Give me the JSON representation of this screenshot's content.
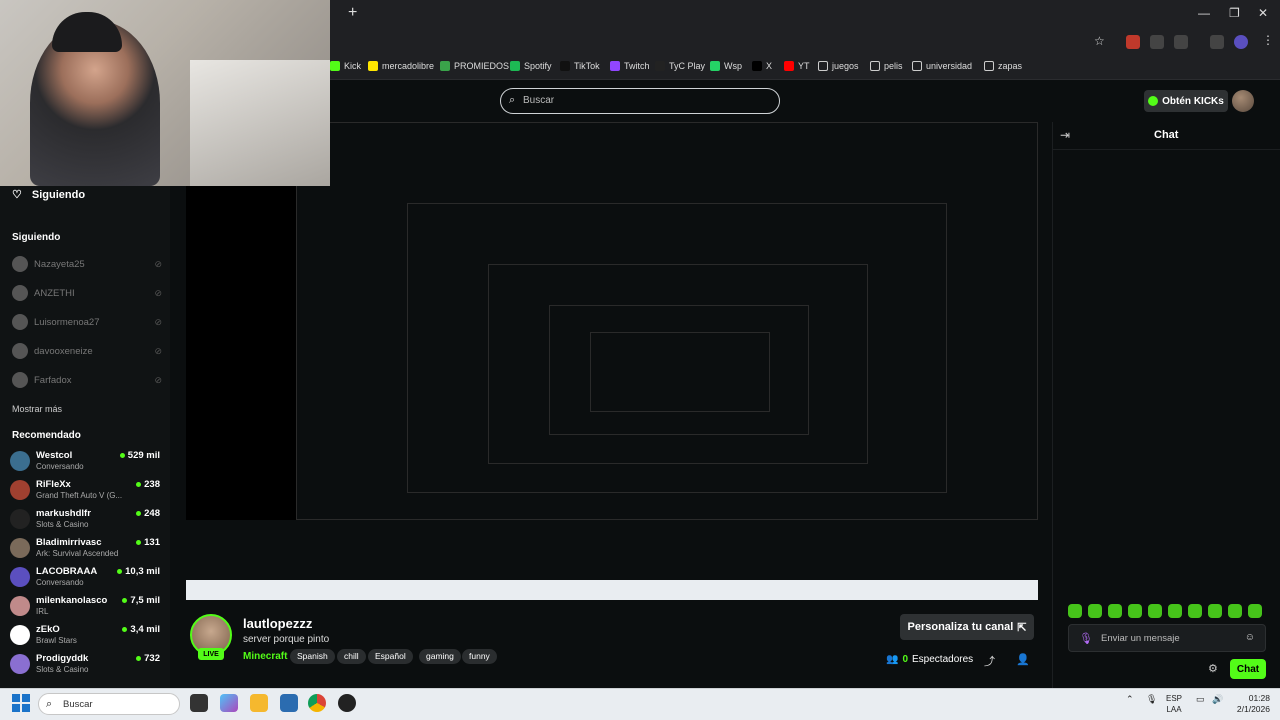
{
  "browser": {
    "new_tab": "+",
    "window_controls": [
      "—",
      "❐",
      "✕"
    ],
    "bookmarks": [
      {
        "label": "Kick",
        "color": "#53fc18"
      },
      {
        "label": "mercadolibre",
        "color": "#ffe600"
      },
      {
        "label": "PROMIEDOS",
        "color": "#3aa34a"
      },
      {
        "label": "Spotify",
        "color": "#1db954"
      },
      {
        "label": "TikTok",
        "color": "#111111"
      },
      {
        "label": "Twitch",
        "color": "#9146ff"
      },
      {
        "label": "TyC Play",
        "color": "#222222"
      },
      {
        "label": "Wsp",
        "color": "#25d366"
      },
      {
        "label": "X",
        "color": "#000000"
      },
      {
        "label": "YT",
        "color": "#ff0000"
      },
      {
        "label": "juegos",
        "color": "folder"
      },
      {
        "label": "pelis",
        "color": "folder"
      },
      {
        "label": "universidad",
        "color": "folder"
      },
      {
        "label": "zapas",
        "color": "folder"
      }
    ]
  },
  "header": {
    "search_placeholder": "Buscar",
    "kicks_button": "Obtén KICKs"
  },
  "sidebar": {
    "following_title": "Siguiendo",
    "following_heading": "Siguiendo",
    "following": [
      "Nazayeta25",
      "ANZETHI",
      "Luisormenoa27",
      "davooxeneize",
      "Farfadox"
    ],
    "show_more": "Mostrar más",
    "recommended_heading": "Recomendado",
    "recommended": [
      {
        "name": "Westcol",
        "category": "Conversando",
        "viewers": "529 mil",
        "color": "#3b6e8f"
      },
      {
        "name": "RiFleXx",
        "category": "Grand Theft Auto V (G...",
        "viewers": "238",
        "color": "#a04030"
      },
      {
        "name": "markushdlfr",
        "category": "Slots & Casino",
        "viewers": "248",
        "color": "#222222"
      },
      {
        "name": "Bladimirrivasc",
        "category": "Ark: Survival Ascended",
        "viewers": "131",
        "color": "#7a6a5a"
      },
      {
        "name": "LACOBRAAA",
        "category": "Conversando",
        "viewers": "10,3 mil",
        "color": "#5b4fbf"
      },
      {
        "name": "milenkanolasco",
        "category": "IRL",
        "viewers": "7,5 mil",
        "color": "#c08a8a"
      },
      {
        "name": "zEkO",
        "category": "Brawl Stars",
        "viewers": "3,4 mil",
        "color": "#ffffff"
      },
      {
        "name": "Prodigyddk",
        "category": "Slots & Casino",
        "viewers": "732",
        "color": "#8a6fd1"
      }
    ]
  },
  "stream": {
    "live": "LIVE",
    "name": "lautlopezzz",
    "title": "server porque pinto",
    "category": "Minecraft",
    "tags": [
      "Spanish",
      "chill",
      "Español",
      "gaming",
      "funny"
    ],
    "customize": "Personaliza tu canal",
    "viewers_count": "0",
    "viewers_label": "Espectadores"
  },
  "chat": {
    "title": "Chat",
    "input_placeholder": "Enviar un mensaje",
    "send": "Chat",
    "emote_count": 10
  },
  "taskbar": {
    "search_placeholder": "Buscar",
    "language": "ESP",
    "layout": "LAA",
    "time": "01:28",
    "date": "2/1/2026"
  }
}
